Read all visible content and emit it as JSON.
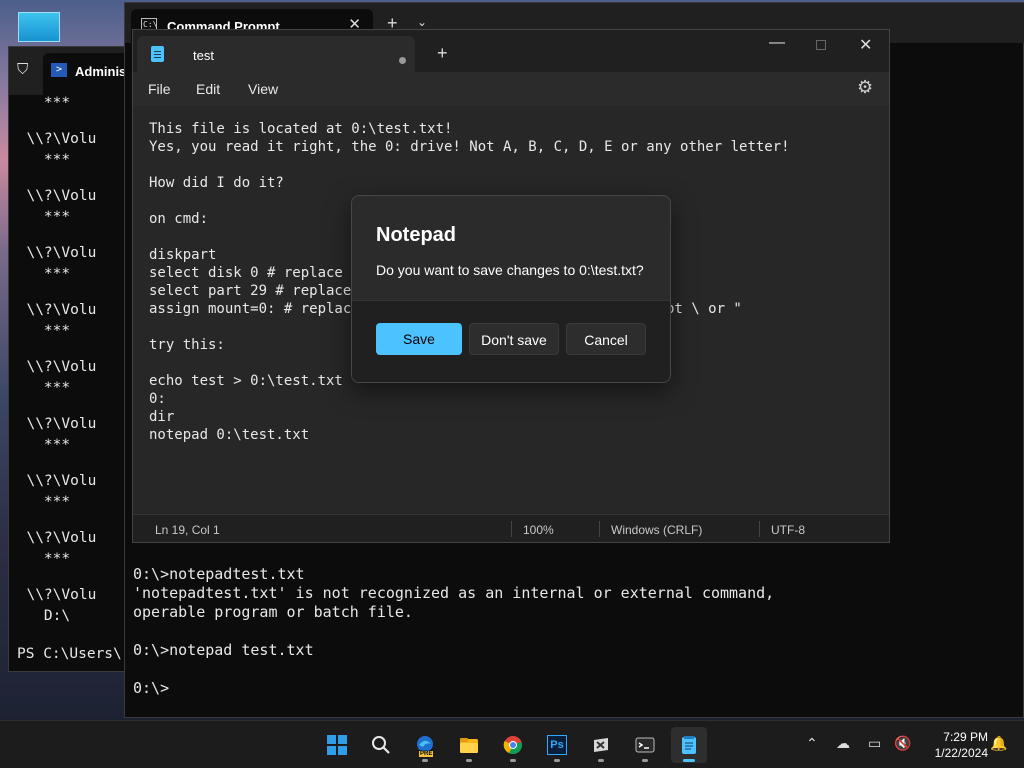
{
  "powershell": {
    "tab_title": "Administ",
    "tab_icon": "powershell-icon",
    "lines": [
      {
        "text": "    ***"
      },
      {
        "text": "  \\\\?\\Volu"
      },
      {
        "text": "    ***"
      },
      {
        "text": "  \\\\?\\Volu"
      },
      {
        "text": "    ***"
      },
      {
        "text": "  \\\\?\\Volu"
      },
      {
        "text": "    ***"
      },
      {
        "text": "  \\\\?\\Volu"
      },
      {
        "text": "    ***"
      },
      {
        "text": "  \\\\?\\Volu"
      },
      {
        "text": "    ***"
      },
      {
        "text": "  \\\\?\\Volu"
      },
      {
        "text": "    ***"
      },
      {
        "text": "  \\\\?\\Volu"
      },
      {
        "text": "    ***"
      },
      {
        "text": "  \\\\?\\Volu"
      },
      {
        "text": "    ***"
      },
      {
        "text": "  \\\\?\\Volu"
      },
      {
        "text": "    D:\\"
      },
      {
        "text": "PS C:\\Users\\"
      }
    ]
  },
  "cmd": {
    "tab_title": "Command Prompt",
    "close_glyph": "✕",
    "new_tab_glyph": "+",
    "dropdown_glyph": "⌄",
    "lines": [
      {
        "text": "0:\\>notepadtest.txt"
      },
      {
        "text": "'notepadtest.txt' is not recognized as an internal or external command,"
      },
      {
        "text": "operable program or batch file."
      },
      {
        "text": "0:\\>notepad test.txt"
      },
      {
        "text": "0:\\>"
      }
    ]
  },
  "notepad": {
    "tab_title": "test",
    "new_tab_glyph": "+",
    "menus": [
      "File",
      "Edit",
      "View"
    ],
    "lines": [
      {
        "text": "This file is located at 0:\\test.txt!"
      },
      {
        "text": "Yes, you read it right, the 0: drive! Not A, B, C, D, E or any other letter!"
      },
      {
        "text": "How did I do it?"
      },
      {
        "text": "on cmd:"
      },
      {
        "text": "diskpart"
      },
      {
        "text": "select disk 0 # replace 0"
      },
      {
        "text": "select part 29 # replace 2"
      },
      {
        "text": "assign mount=0: # replace"
      },
      {
        "text": "pt \\ or \""
      },
      {
        "text": "try this:"
      },
      {
        "text": "echo test > 0:\\test.txt"
      },
      {
        "text": "0:"
      },
      {
        "text": "dir"
      },
      {
        "text": "notepad 0:\\test.txt"
      }
    ],
    "status": {
      "position": "Ln 19, Col 1",
      "zoom": "100%",
      "line_ending": "Windows (CRLF)",
      "encoding": "UTF-8"
    }
  },
  "dialog": {
    "title": "Notepad",
    "message": "Do you want to save changes to 0:\\test.txt?",
    "save_label": "Save",
    "dont_save_label": "Don't save",
    "cancel_label": "Cancel",
    "accent": "#4cc2ff"
  },
  "taskbar": {
    "apps": [
      {
        "icon": "windows-start-icon",
        "active": false,
        "running": false
      },
      {
        "icon": "search-icon",
        "active": false,
        "running": false
      },
      {
        "icon": "edge-canary-icon",
        "active": false,
        "running": true
      },
      {
        "icon": "file-explorer-icon",
        "active": false,
        "running": true
      },
      {
        "icon": "chrome-icon",
        "active": false,
        "running": true
      },
      {
        "icon": "photoshop-icon",
        "active": false,
        "running": true
      },
      {
        "icon": "app-icon",
        "active": false,
        "running": true
      },
      {
        "icon": "terminal-icon",
        "active": false,
        "running": true
      },
      {
        "icon": "notepad-icon",
        "active": true,
        "running": true
      }
    ],
    "photoshop_label": "Ps",
    "edge_badge": "PRE",
    "clock": {
      "time": "7:29 PM",
      "date": "1/22/2024"
    }
  }
}
